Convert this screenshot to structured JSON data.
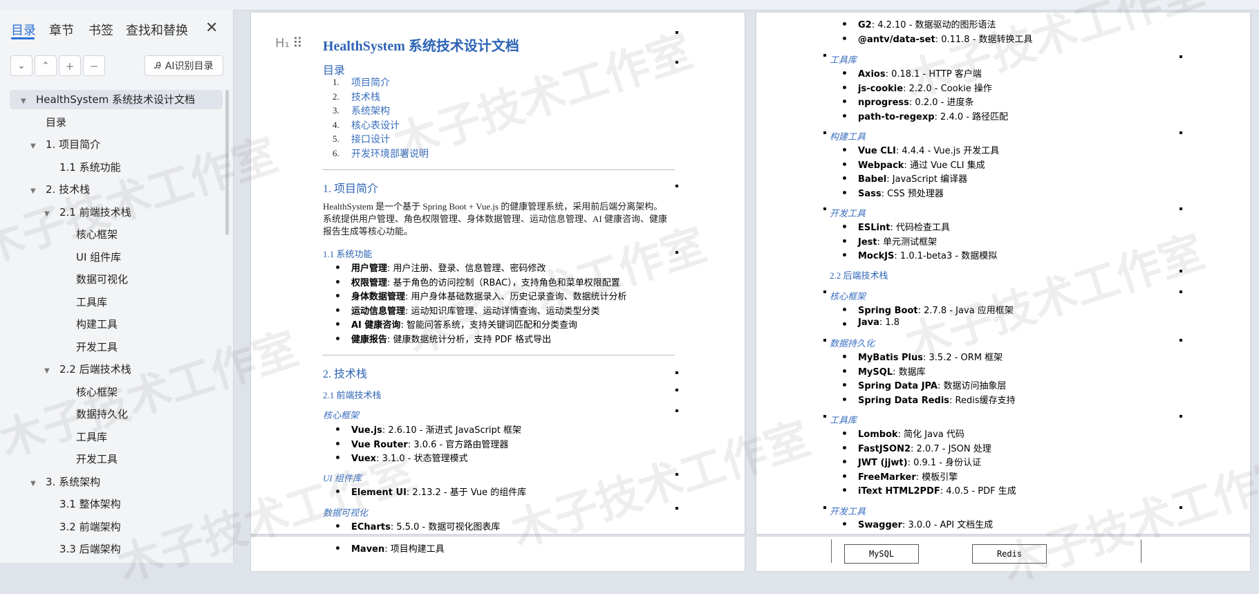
{
  "sidebar": {
    "tabs": [
      "目录",
      "章节",
      "书签",
      "查找和替换"
    ],
    "ai_button": "AI识别目录",
    "toc": [
      {
        "label": "HealthSystem 系统技术设计文档",
        "level": 0,
        "arrow": true,
        "selected": true
      },
      {
        "label": "目录",
        "level": 1,
        "arrow": false
      },
      {
        "label": "1. 项目简介",
        "level": 1,
        "arrow": true
      },
      {
        "label": "1.1 系统功能",
        "level": 2,
        "arrow": false
      },
      {
        "label": "2. 技术栈",
        "level": 1,
        "arrow": true
      },
      {
        "label": "2.1 前端技术栈",
        "level": 2,
        "arrow": true
      },
      {
        "label": "核心框架",
        "level": 3,
        "arrow": false
      },
      {
        "label": "UI 组件库",
        "level": 3,
        "arrow": false
      },
      {
        "label": "数据可视化",
        "level": 3,
        "arrow": false
      },
      {
        "label": "工具库",
        "level": 3,
        "arrow": false
      },
      {
        "label": "构建工具",
        "level": 3,
        "arrow": false
      },
      {
        "label": "开发工具",
        "level": 3,
        "arrow": false
      },
      {
        "label": "2.2 后端技术栈",
        "level": 2,
        "arrow": true
      },
      {
        "label": "核心框架",
        "level": 3,
        "arrow": false
      },
      {
        "label": "数据持久化",
        "level": 3,
        "arrow": false
      },
      {
        "label": "工具库",
        "level": 3,
        "arrow": false
      },
      {
        "label": "开发工具",
        "level": 3,
        "arrow": false
      },
      {
        "label": "3. 系统架构",
        "level": 1,
        "arrow": true
      },
      {
        "label": "3.1 整体架构",
        "level": 2,
        "arrow": false
      },
      {
        "label": "3.2 前端架构",
        "level": 2,
        "arrow": false
      },
      {
        "label": "3.3 后端架构",
        "level": 2,
        "arrow": false
      }
    ]
  },
  "watermark": "木子技术工作室",
  "left_page": {
    "title": "HealthSystem 系统技术设计文档",
    "toc_heading": "目录",
    "toc_links": [
      "项目简介",
      "技术栈",
      "系统架构",
      "核心表设计",
      "接口设计",
      "开发环境部署说明"
    ],
    "sec1": "1. 项目简介",
    "intro": "HealthSystem 是一个基于 Spring Boot + Vue.js 的健康管理系统，采用前后端分离架构。系统提供用户管理、角色权限管理、身体数据管理、运动信息管理、AI 健康咨询、健康报告生成等核心功能。",
    "sec11": "1.1 系统功能",
    "features": [
      {
        "b": "用户管理",
        "t": ": 用户注册、登录、信息管理、密码修改"
      },
      {
        "b": "权限管理",
        "t": ": 基于角色的访问控制（RBAC），支持角色和菜单权限配置"
      },
      {
        "b": "身体数据管理",
        "t": ": 用户身体基础数据录入、历史记录查询、数据统计分析"
      },
      {
        "b": "运动信息管理",
        "t": ": 运动知识库管理、运动详情查询、运动类型分类"
      },
      {
        "b": "AI 健康咨询",
        "t": ": 智能问答系统，支持关键词匹配和分类查询"
      },
      {
        "b": "健康报告",
        "t": ": 健康数据统计分析，支持 PDF 格式导出"
      }
    ],
    "sec2": "2. 技术栈",
    "sec21": "2.1 前端技术栈",
    "core_fw": "核心框架",
    "core_items": [
      {
        "b": "Vue.js",
        "t": ": 2.6.10 - 渐进式 JavaScript 框架"
      },
      {
        "b": "Vue Router",
        "t": ": 3.0.6 - 官方路由管理器"
      },
      {
        "b": "Vuex",
        "t": ": 3.1.0 - 状态管理模式"
      }
    ],
    "ui_lib": "UI 组件库",
    "ui_items": [
      {
        "b": "Element UI",
        "t": ": 2.13.2 - 基于 Vue 的组件库"
      }
    ],
    "dataviz": "数据可视化",
    "viz_items": [
      {
        "b": "ECharts",
        "t": ": 5.5.0 - 数据可视化图表库"
      }
    ],
    "below_item": {
      "b": "Maven",
      "t": ": 项目构建工具"
    }
  },
  "right_page": {
    "top_items": [
      {
        "b": "G2",
        "t": ": 4.2.10 - 数据驱动的图形语法"
      },
      {
        "b": "@antv/data-set",
        "t": ": 0.11.8 - 数据转换工具"
      }
    ],
    "tools": "工具库",
    "tool_items": [
      {
        "b": "Axios",
        "t": ": 0.18.1 - HTTP 客户端"
      },
      {
        "b": "js-cookie",
        "t": ": 2.2.0 - Cookie 操作"
      },
      {
        "b": "nprogress",
        "t": ": 0.2.0 - 进度条"
      },
      {
        "b": "path-to-regexp",
        "t": ": 2.4.0 - 路径匹配"
      }
    ],
    "build": "构建工具",
    "build_items": [
      {
        "b": "Vue CLI",
        "t": ": 4.4.4 - Vue.js 开发工具"
      },
      {
        "b": "Webpack",
        "t": ": 通过 Vue CLI 集成"
      },
      {
        "b": "Babel",
        "t": ": JavaScript 编译器"
      },
      {
        "b": "Sass",
        "t": ": CSS 预处理器"
      }
    ],
    "dev": "开发工具",
    "dev_items": [
      {
        "b": "ESLint",
        "t": ": 代码检查工具"
      },
      {
        "b": "Jest",
        "t": ": 单元测试框架"
      },
      {
        "b": "MockJS",
        "t": ": 1.0.1-beta3 - 数据模拟"
      }
    ],
    "sec22": "2.2 后端技术栈",
    "core_fw": "核心框架",
    "core_items": [
      {
        "b": "Spring Boot",
        "t": ": 2.7.8 - Java 应用框架"
      },
      {
        "b": "Java",
        "t": ": 1.8"
      }
    ],
    "persist": "数据持久化",
    "persist_items": [
      {
        "b": "MyBatis Plus",
        "t": ": 3.5.2 - ORM 框架"
      },
      {
        "b": "MySQL",
        "t": ": 数据库"
      },
      {
        "b": "Spring Data JPA",
        "t": ": 数据访问抽象层"
      },
      {
        "b": "Spring Data Redis",
        "t": ": Redis缓存支持"
      }
    ],
    "tools2": "工具库",
    "tool2_items": [
      {
        "b": "Lombok",
        "t": ": 简化 Java 代码"
      },
      {
        "b": "FastJSON2",
        "t": ": 2.0.7 - JSON 处理"
      },
      {
        "b": "JWT (jjwt)",
        "t": ": 0.9.1 - 身份认证"
      },
      {
        "b": "FreeMarker",
        "t": ": 模板引擎"
      },
      {
        "b": "iText HTML2PDF",
        "t": ": 4.0.5 - PDF 生成"
      }
    ],
    "dev2": "开发工具",
    "dev2_items": [
      {
        "b": "Swagger",
        "t": ": 3.0.0 - API 文档生成"
      }
    ],
    "diagram_boxes": [
      "MySQL",
      "Redis"
    ]
  }
}
